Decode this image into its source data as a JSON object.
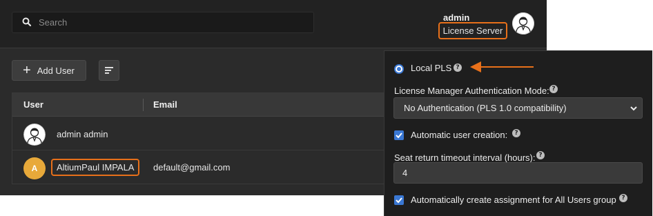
{
  "header": {
    "search": {
      "placeholder": "Search",
      "value": ""
    },
    "user": {
      "name": "admin",
      "license_button": "License Server"
    }
  },
  "toolbar": {
    "add_user_label": "Add User"
  },
  "table": {
    "columns": [
      "User",
      "Email"
    ],
    "rows": [
      {
        "name": "admin admin",
        "email": ""
      },
      {
        "initial": "A",
        "name": "AltiumPaul IMPALA",
        "email": "default@gmail.com"
      }
    ]
  },
  "license_panel": {
    "mode_option": "Local PLS",
    "auth_mode_label": "License Manager Authentication Mode:",
    "auth_mode_value": "No Authentication (PLS 1.0 compatibility)",
    "auto_user_creation_label": "Automatic user creation:",
    "seat_timeout_label": "Seat return timeout interval (hours):",
    "seat_timeout_value": "4",
    "auto_assignment_label": "Automatically create assignment for All Users group",
    "help_glyph": "?"
  },
  "colors": {
    "highlight": "#e8701a",
    "accent": "#3a78d4",
    "avatar_initial_bg": "#e8a93a"
  }
}
